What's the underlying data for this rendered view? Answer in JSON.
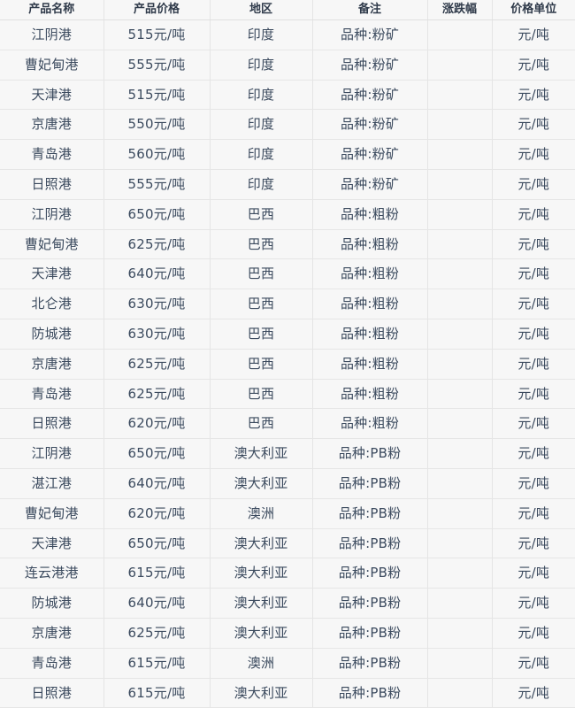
{
  "table": {
    "columns": [
      {
        "key": "name",
        "label": "产品名称",
        "class": "c-name"
      },
      {
        "key": "price",
        "label": "产品价格",
        "class": "c-price"
      },
      {
        "key": "region",
        "label": "地区",
        "class": "c-region"
      },
      {
        "key": "note",
        "label": "备注",
        "class": "c-note"
      },
      {
        "key": "change",
        "label": "涨跌幅",
        "class": "c-change"
      },
      {
        "key": "unit",
        "label": "价格单位",
        "class": "c-unit"
      }
    ],
    "header_text_color": "#2f3a4a",
    "body_text_color": "#3b4a5e",
    "cell_background": "#f7f7f7",
    "border_color": "#e4e4e4",
    "rows": [
      {
        "name": "江阴港",
        "price": "515元/吨",
        "region": "印度",
        "note": "品种:粉矿",
        "change": "",
        "unit": "元/吨"
      },
      {
        "name": "曹妃甸港",
        "price": "555元/吨",
        "region": "印度",
        "note": "品种:粉矿",
        "change": "",
        "unit": "元/吨"
      },
      {
        "name": "天津港",
        "price": "515元/吨",
        "region": "印度",
        "note": "品种:粉矿",
        "change": "",
        "unit": "元/吨"
      },
      {
        "name": "京唐港",
        "price": "550元/吨",
        "region": "印度",
        "note": "品种:粉矿",
        "change": "",
        "unit": "元/吨"
      },
      {
        "name": "青岛港",
        "price": "560元/吨",
        "region": "印度",
        "note": "品种:粉矿",
        "change": "",
        "unit": "元/吨"
      },
      {
        "name": "日照港",
        "price": "555元/吨",
        "region": "印度",
        "note": "品种:粉矿",
        "change": "",
        "unit": "元/吨"
      },
      {
        "name": "江阴港",
        "price": "650元/吨",
        "region": "巴西",
        "note": "品种:粗粉",
        "change": "",
        "unit": "元/吨"
      },
      {
        "name": "曹妃甸港",
        "price": "625元/吨",
        "region": "巴西",
        "note": "品种:粗粉",
        "change": "",
        "unit": "元/吨"
      },
      {
        "name": "天津港",
        "price": "640元/吨",
        "region": "巴西",
        "note": "品种:粗粉",
        "change": "",
        "unit": "元/吨"
      },
      {
        "name": "北仑港",
        "price": "630元/吨",
        "region": "巴西",
        "note": "品种:粗粉",
        "change": "",
        "unit": "元/吨"
      },
      {
        "name": "防城港",
        "price": "630元/吨",
        "region": "巴西",
        "note": "品种:粗粉",
        "change": "",
        "unit": "元/吨"
      },
      {
        "name": "京唐港",
        "price": "625元/吨",
        "region": "巴西",
        "note": "品种:粗粉",
        "change": "",
        "unit": "元/吨"
      },
      {
        "name": "青岛港",
        "price": "625元/吨",
        "region": "巴西",
        "note": "品种:粗粉",
        "change": "",
        "unit": "元/吨"
      },
      {
        "name": "日照港",
        "price": "620元/吨",
        "region": "巴西",
        "note": "品种:粗粉",
        "change": "",
        "unit": "元/吨"
      },
      {
        "name": "江阴港",
        "price": "650元/吨",
        "region": "澳大利亚",
        "note": "品种:PB粉",
        "change": "",
        "unit": "元/吨"
      },
      {
        "name": "湛江港",
        "price": "640元/吨",
        "region": "澳大利亚",
        "note": "品种:PB粉",
        "change": "",
        "unit": "元/吨"
      },
      {
        "name": "曹妃甸港",
        "price": "620元/吨",
        "region": "澳洲",
        "note": "品种:PB粉",
        "change": "",
        "unit": "元/吨"
      },
      {
        "name": "天津港",
        "price": "650元/吨",
        "region": "澳大利亚",
        "note": "品种:PB粉",
        "change": "",
        "unit": "元/吨"
      },
      {
        "name": "连云港港",
        "price": "615元/吨",
        "region": "澳大利亚",
        "note": "品种:PB粉",
        "change": "",
        "unit": "元/吨"
      },
      {
        "name": "防城港",
        "price": "640元/吨",
        "region": "澳大利亚",
        "note": "品种:PB粉",
        "change": "",
        "unit": "元/吨"
      },
      {
        "name": "京唐港",
        "price": "625元/吨",
        "region": "澳大利亚",
        "note": "品种:PB粉",
        "change": "",
        "unit": "元/吨"
      },
      {
        "name": "青岛港",
        "price": "615元/吨",
        "region": "澳洲",
        "note": "品种:PB粉",
        "change": "",
        "unit": "元/吨"
      },
      {
        "name": "日照港",
        "price": "615元/吨",
        "region": "澳大利亚",
        "note": "品种:PB粉",
        "change": "",
        "unit": "元/吨"
      }
    ]
  }
}
